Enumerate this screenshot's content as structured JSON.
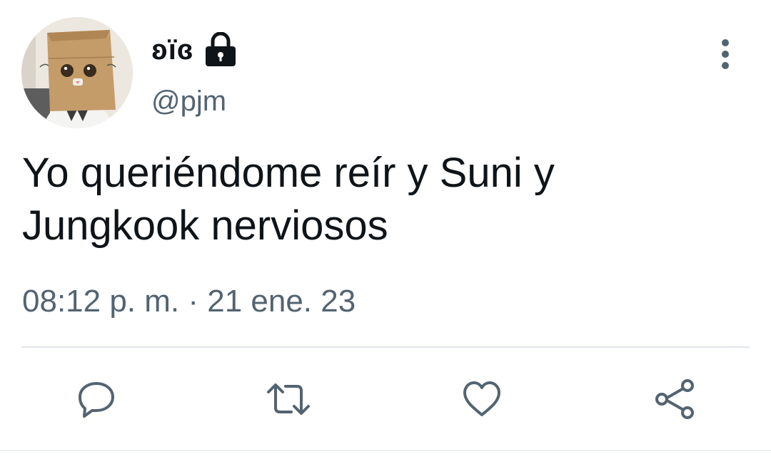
{
  "user": {
    "display_name": "ʚïɞ",
    "handle": "@pjm",
    "protected": true,
    "lock_icon": "lock-icon",
    "avatar": "cat wearing paper bag avatar"
  },
  "tweet": {
    "text": "Yo queriéndome reír y Suni y Jungkook nerviosos",
    "timestamp": "08:12 p. m. · 21 ene. 23"
  },
  "actions": [
    {
      "name": "reply",
      "icon": "reply-icon"
    },
    {
      "name": "retweet",
      "icon": "retweet-icon"
    },
    {
      "name": "like",
      "icon": "heart-icon"
    },
    {
      "name": "share",
      "icon": "share-icon"
    }
  ],
  "colors": {
    "text_primary": "#0f1419",
    "text_secondary": "#536471",
    "divider": "#e1e6ea",
    "icon": "#536471"
  }
}
